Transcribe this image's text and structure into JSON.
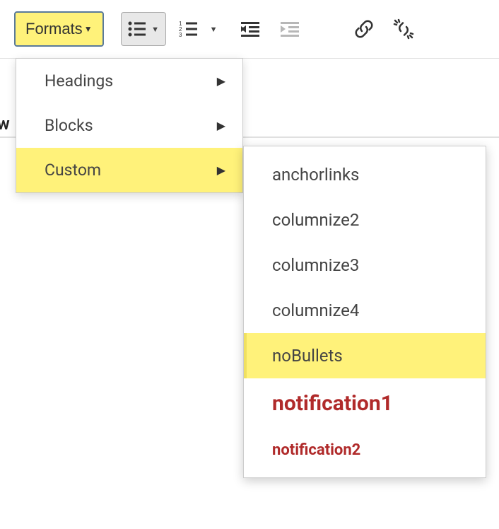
{
  "toolbar": {
    "formats_label": "Formats"
  },
  "content": {
    "partial_text": "w"
  },
  "formats_menu": {
    "items": [
      {
        "label": "Headings",
        "has_submenu": true,
        "highlighted": false
      },
      {
        "label": "Blocks",
        "has_submenu": true,
        "highlighted": false
      },
      {
        "label": "Custom",
        "has_submenu": true,
        "highlighted": true
      }
    ]
  },
  "custom_submenu": {
    "items": [
      {
        "label": "anchorlinks",
        "style": "normal",
        "highlighted": false
      },
      {
        "label": "columnize2",
        "style": "normal",
        "highlighted": false
      },
      {
        "label": "columnize3",
        "style": "normal",
        "highlighted": false
      },
      {
        "label": "columnize4",
        "style": "normal",
        "highlighted": false
      },
      {
        "label": "noBullets",
        "style": "normal",
        "highlighted": true
      },
      {
        "label": "notification1",
        "style": "notification1",
        "highlighted": false
      },
      {
        "label": "notification2",
        "style": "notification2",
        "highlighted": false
      }
    ]
  }
}
